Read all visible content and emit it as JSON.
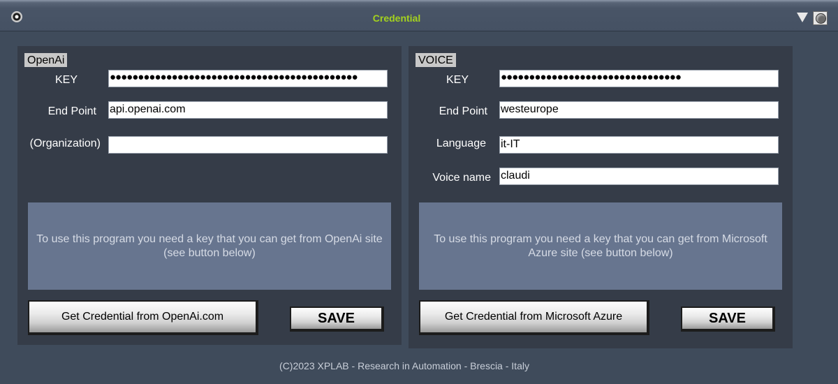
{
  "window": {
    "title": "Credential",
    "menu_icon": "system-menu-icon",
    "minimize_icon": "triangle-down-icon",
    "close_icon": "circle-button-icon"
  },
  "openai": {
    "group_label": "OpenAi",
    "key_label": "KEY",
    "key_value": "●●●●●●●●●●●●●●●●●●●●●●●●●●●●●●●●●●●●●●●●●●●●",
    "endpoint_label": "End Point",
    "endpoint_value": "api.openai.com",
    "org_label": "(Organization)",
    "org_value": "",
    "info": "To use this program you need a key that you can get from OpenAi site (see button below)",
    "get_button": "Get Credential from OpenAi.com",
    "save_button": "SAVE"
  },
  "voice": {
    "group_label": "VOICE",
    "key_label": "KEY",
    "key_value": "●●●●●●●●●●●●●●●●●●●●●●●●●●●●●●●●",
    "endpoint_label": "End Point",
    "endpoint_value": "westeurope",
    "language_label": "Language",
    "language_value": "it-IT",
    "voicename_label": "Voice name",
    "voicename_value": "claudi",
    "info": "To use this program you need a key that you can get from Microsoft Azure site (see button below)",
    "get_button": "Get Credential from Microsoft Azure",
    "save_button": "SAVE"
  },
  "footer": "(C)2023 XPLAB - Research in Automation - Brescia - Italy",
  "colors": {
    "background": "#3f4b5b",
    "panel": "#353c48",
    "title": "#a4d21e",
    "infobox": "#67758f"
  }
}
